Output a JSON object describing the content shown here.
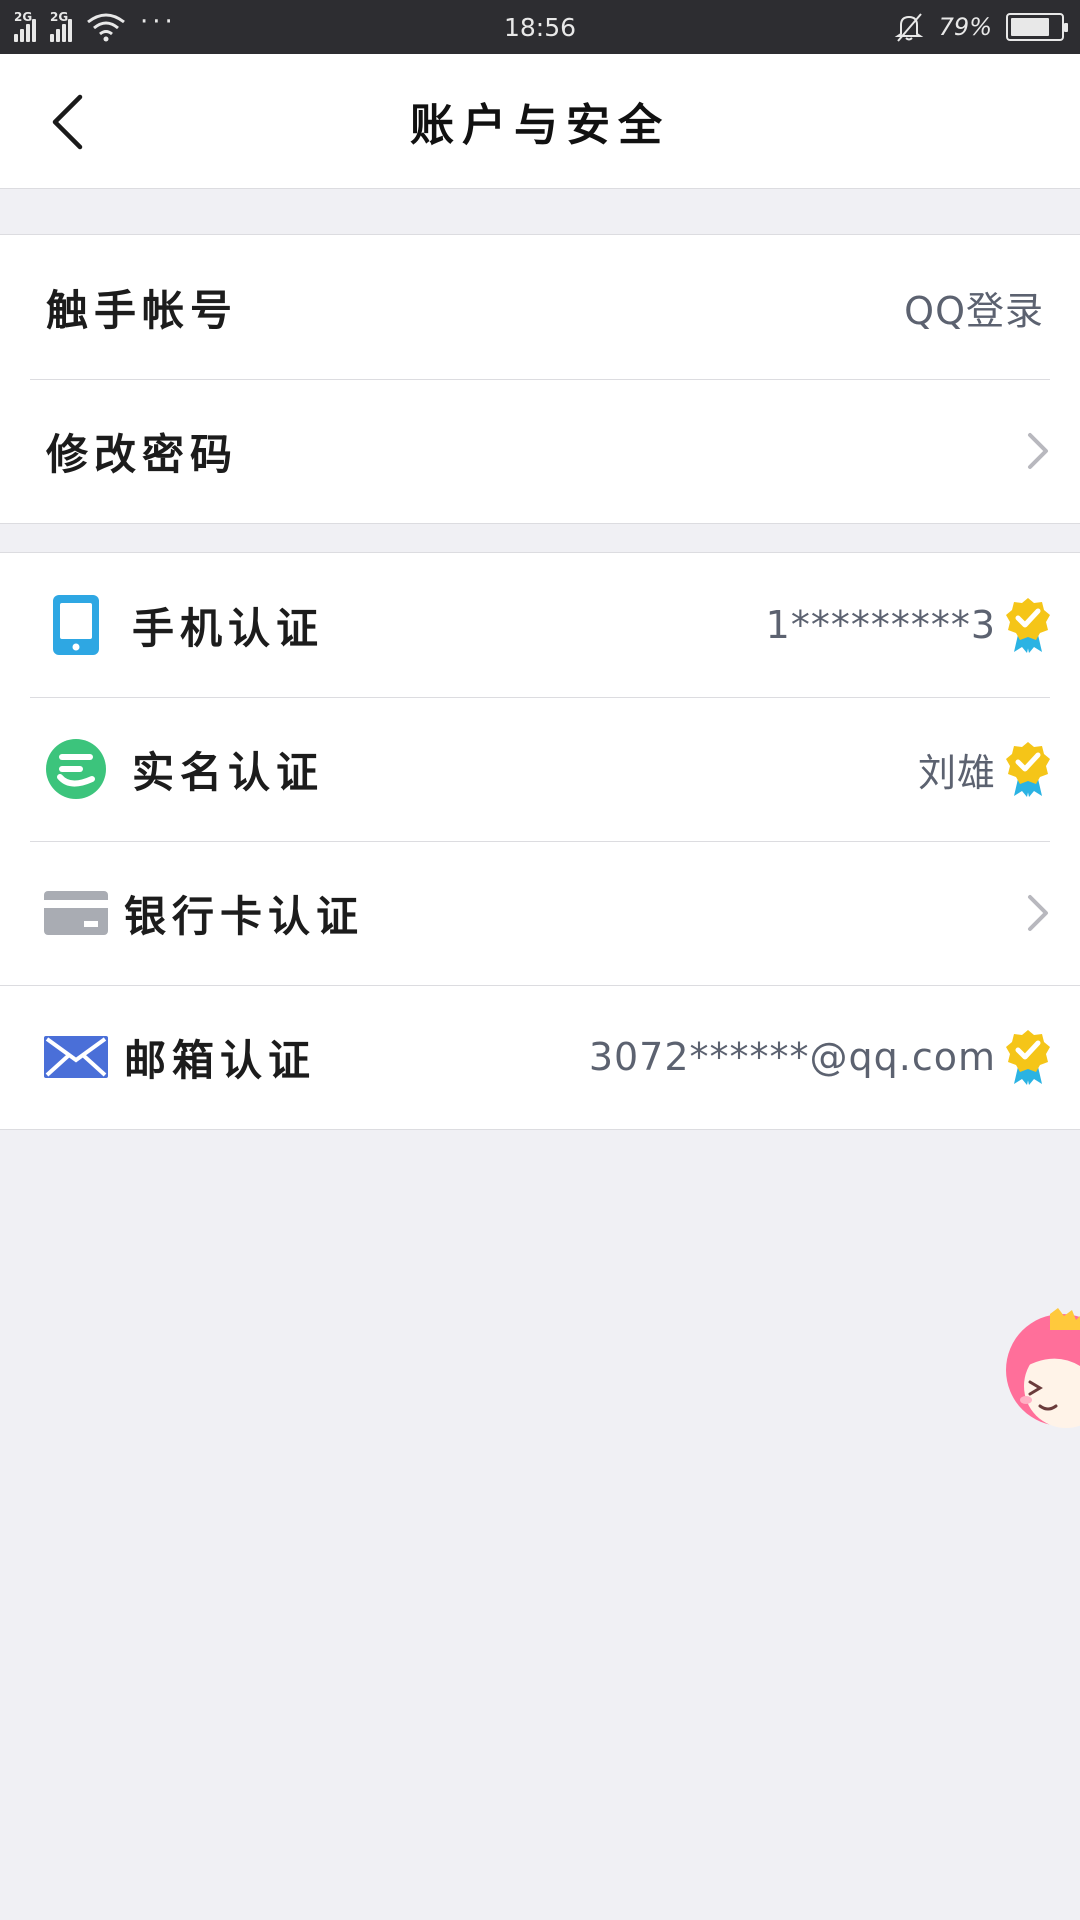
{
  "status_bar": {
    "signal1_tag": "2G",
    "signal2_tag": "2G",
    "more": "···",
    "time": "18:56",
    "battery_percent": "79%",
    "battery_level": 0.79
  },
  "nav": {
    "title": "账户与安全"
  },
  "account_section": {
    "rows": [
      {
        "label": "触手帐号",
        "value": "QQ登录"
      },
      {
        "label": "修改密码"
      }
    ]
  },
  "verify_section": {
    "rows": [
      {
        "label": "手机认证",
        "value": "1*********3",
        "icon": "phone-icon",
        "verified": true
      },
      {
        "label": "实名认证",
        "value": "刘雄",
        "icon": "real-name-icon",
        "verified": true
      },
      {
        "label": "银行卡认证",
        "icon": "bank-card-icon",
        "verified": false
      },
      {
        "label": "邮箱认证",
        "value": "3072******@qq.com",
        "icon": "mail-icon",
        "verified": true
      }
    ]
  },
  "colors": {
    "status_bar": "#2d2d31",
    "phone_icon": "#2ea7e3",
    "real_name_icon": "#3cc47c",
    "bank_icon": "#a9acb3",
    "mail_icon": "#4a6fd8",
    "badge_gold": "#f5c518",
    "badge_ribbon": "#2bb3e3"
  }
}
